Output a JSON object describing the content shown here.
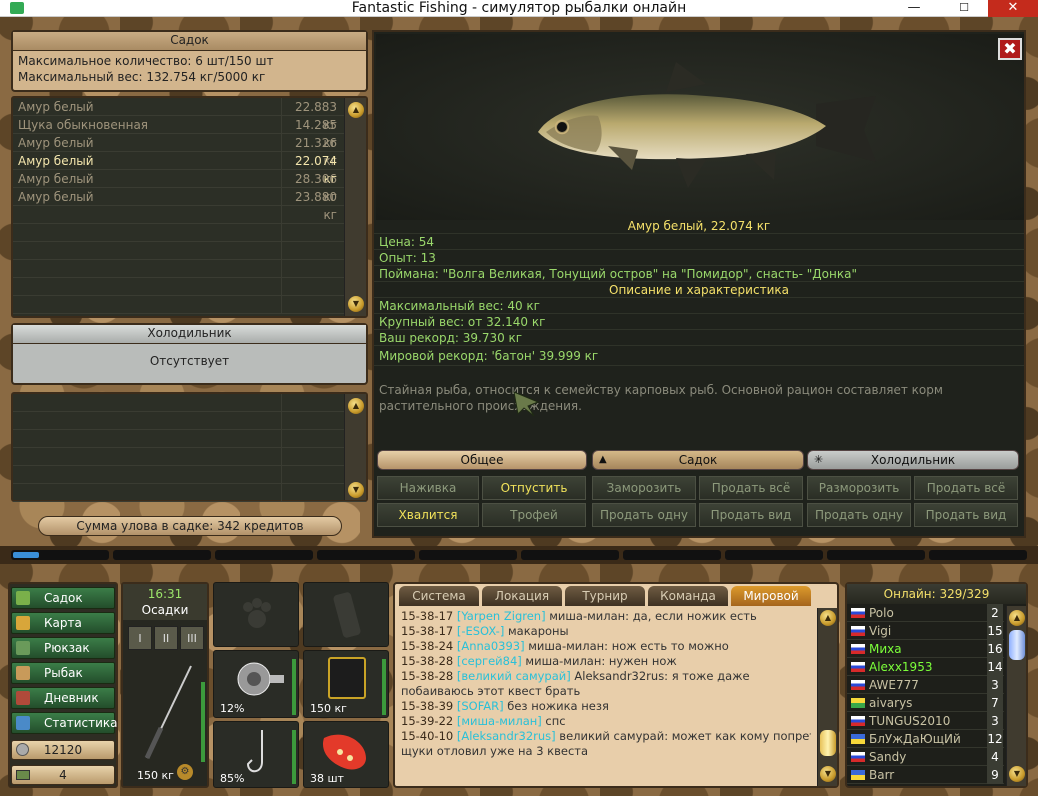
{
  "window": {
    "title": "Fantastic Fishing - симулятор рыбалки онлайн",
    "min": "—",
    "max": "☐",
    "close": "✕"
  },
  "sadok": {
    "title": "Садок",
    "max_count": "Максимальное количество: 6 шт/150 шт",
    "max_weight": "Максимальный вес: 132.754 кг/5000 кг",
    "fish": [
      {
        "name": "Амур белый",
        "weight": "22.883 кг"
      },
      {
        "name": "Щука обыкновенная",
        "weight": "14.285 кг"
      },
      {
        "name": "Амур белый",
        "weight": "21.326 кг"
      },
      {
        "name": "Амур белый",
        "weight": "22.074 кг"
      },
      {
        "name": "Амур белый",
        "weight": "28.306 кг"
      },
      {
        "name": "Амур белый",
        "weight": "23.880 кг"
      }
    ]
  },
  "fridge": {
    "title": "Холодильник",
    "status": "Отсутствует"
  },
  "sum": "Сумма улова в садке: 342 кредитов",
  "detail": {
    "title": "Амур белый, 22.074 кг",
    "price": "Цена: 54",
    "exp": "Опыт: 13",
    "caught": "Поймана: \"Волга Великая, Тонущий остров\" на \"Помидор\", снасть- \"Донка\"",
    "desc_title": "Описание и характеристика",
    "max_w": "Максимальный вес: 40 кг",
    "big_w": "Крупный вес: от 32.140 кг",
    "your_rec": "Ваш рекорд: 39.730 кг",
    "world_rec": "Мировой рекорд: 'батон' 39.999 кг",
    "desc": "Стайная рыба, относится к семейству карповых рыб. Основной рацион составляет корм растительного происхождения.",
    "close": "✖"
  },
  "tabs": {
    "general": "Общее",
    "sadok": "Садок",
    "fridge": "Холодильник"
  },
  "buttons": {
    "bait": "Наживка",
    "release": "Отпустить",
    "boast": "Хвалится",
    "trophy": "Трофей",
    "freeze": "Заморозить",
    "sell_all": "Продать всё",
    "sell_one": "Продать одну",
    "sell_kind": "Продать вид",
    "unfreeze": "Разморозить",
    "sell_all2": "Продать всё",
    "sell_one2": "Продать одну",
    "sell_kind2": "Продать вид"
  },
  "menu": [
    "Садок",
    "Карта",
    "Рюкзак",
    "Рыбак",
    "Дневник",
    "Статистика"
  ],
  "money": "12120",
  "level": "4",
  "time": {
    "clock": "16:31",
    "weather": "Осадки"
  },
  "rod": {
    "label": "150 кг",
    "slots": [
      "I",
      "II",
      "III"
    ]
  },
  "gear": {
    "reel": "12%",
    "line": "150 кг",
    "hook": "85%",
    "bait": "38 шт"
  },
  "chat": {
    "tabs": [
      "Система",
      "Локация",
      "Турнир",
      "Команда",
      "Мировой"
    ],
    "lines": [
      {
        "time": "15-38-17",
        "nick": "[Yarpen Zigren]",
        "text": " миша-милан: да, если ножик есть"
      },
      {
        "time": "15-38-17",
        "nick": "[-ESOX-]",
        "text": " макароны"
      },
      {
        "time": "15-38-24",
        "nick": "[Anna0393]",
        "text": " миша-милан: нож есть то можно"
      },
      {
        "time": "15-38-28",
        "nick": "[сергей84]",
        "text": " миша-милан: нужен нож"
      },
      {
        "time": "15-38-28",
        "nick": "[великий самурай]",
        "text": " Aleksandr32rus: я тоже даже"
      },
      {
        "time": "",
        "nick": "",
        "text": "побаиваюсь этот квест брать"
      },
      {
        "time": "15-38-39",
        "nick": "[SOFAR]",
        "text": " без ножика незя"
      },
      {
        "time": "15-39-22",
        "nick": "[миша-милан]",
        "text": " спс"
      },
      {
        "time": "15-40-10",
        "nick": "[Aleksandr32rus]",
        "text": " великий самурай: может как кому попрет"
      },
      {
        "time": "",
        "nick": "",
        "text": "щуки отловил уже на 3 квеста"
      }
    ]
  },
  "online": {
    "title": "Онлайн: 329/329",
    "users": [
      {
        "name": "Polo",
        "n": "2"
      },
      {
        "name": "Vigi",
        "n": "15"
      },
      {
        "name": "Миха",
        "n": "16"
      },
      {
        "name": "Alexx1953",
        "n": "14"
      },
      {
        "name": "AWE777",
        "n": "3"
      },
      {
        "name": "aivarys",
        "n": "7"
      },
      {
        "name": "TUNGUS2010",
        "n": "3"
      },
      {
        "name": "БлУжДаЮщИй",
        "n": "12"
      },
      {
        "name": "Sandy",
        "n": "4"
      },
      {
        "name": "Barr",
        "n": "9"
      }
    ]
  }
}
